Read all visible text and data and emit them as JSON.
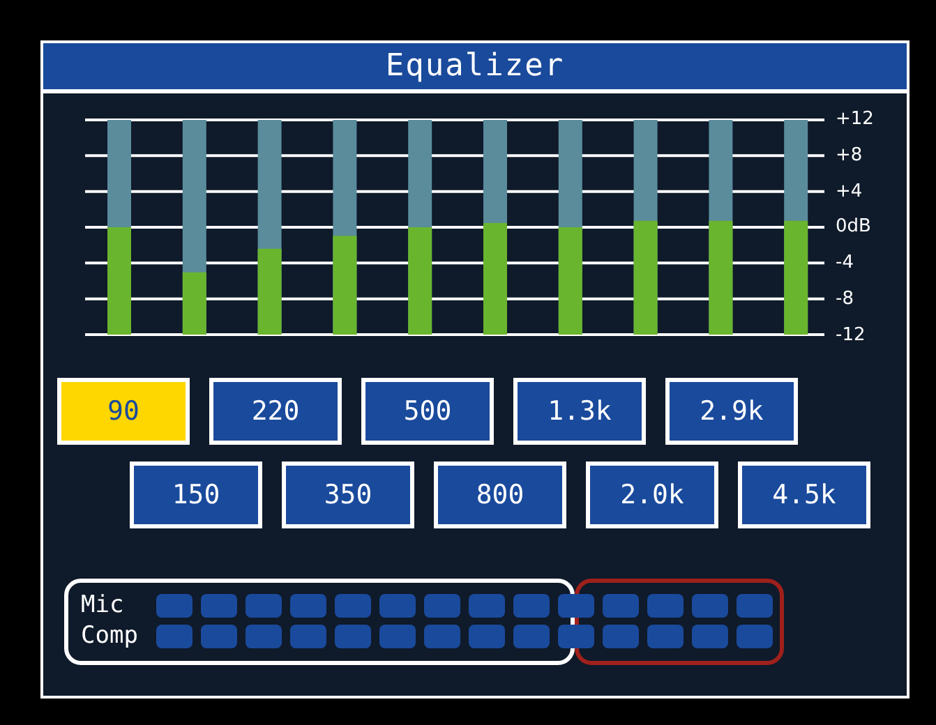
{
  "window": {
    "title": "Equalizer"
  },
  "bands": [
    {
      "level": 0.5
    },
    {
      "level": 0.29
    },
    {
      "level": 0.4
    },
    {
      "level": 0.46
    },
    {
      "level": 0.5
    },
    {
      "level": 0.52
    },
    {
      "level": 0.5
    },
    {
      "level": 0.53
    },
    {
      "level": 0.53
    },
    {
      "level": 0.53
    }
  ],
  "scale": [
    "+12",
    "+8",
    "+4",
    "0dB",
    "-4",
    "-8",
    "-12"
  ],
  "frequency_rows": [
    [
      {
        "label": "90",
        "selected": true
      },
      {
        "label": "220",
        "selected": false
      },
      {
        "label": "500",
        "selected": false
      },
      {
        "label": "1.3k",
        "selected": false
      },
      {
        "label": "2.9k",
        "selected": false
      }
    ],
    [
      {
        "label": "150",
        "selected": false
      },
      {
        "label": "350",
        "selected": false
      },
      {
        "label": "800",
        "selected": false
      },
      {
        "label": "2.0k",
        "selected": false
      },
      {
        "label": "4.5k",
        "selected": false
      }
    ]
  ],
  "meters": [
    {
      "label": "Mic"
    },
    {
      "label": "Comp"
    }
  ]
}
